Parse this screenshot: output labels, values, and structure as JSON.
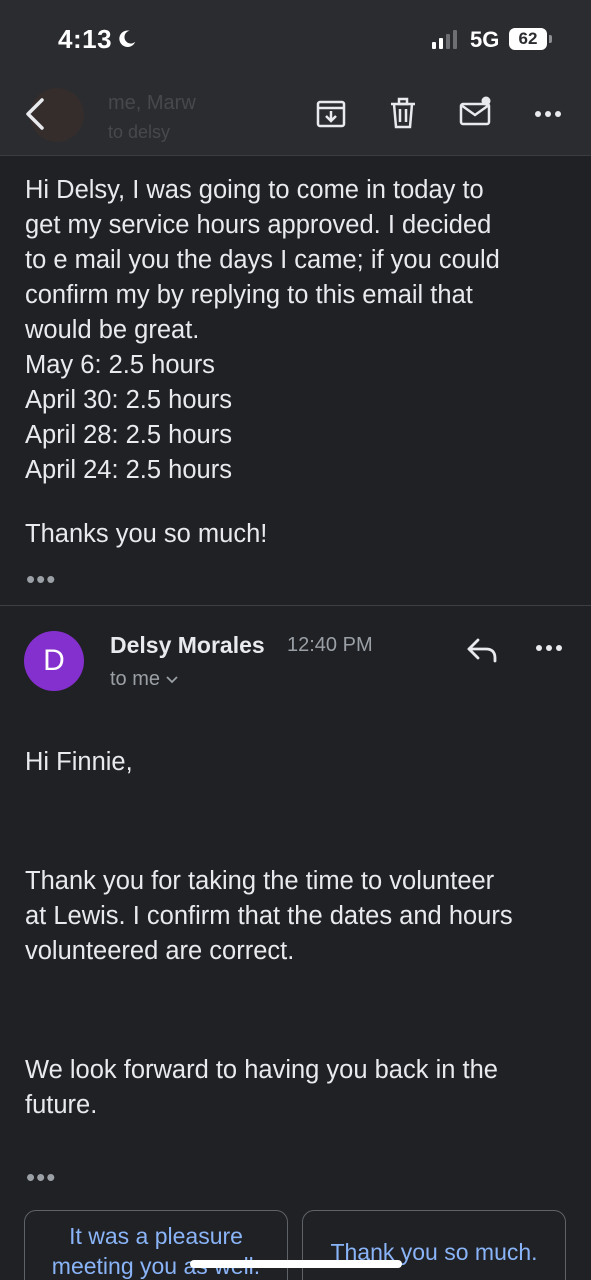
{
  "status_bar": {
    "time": "4:13",
    "network": "5G",
    "battery": "62"
  },
  "toolbar": {
    "ghost_title": "me, Marw",
    "ghost_subtitle": "to delsy"
  },
  "first_message": {
    "lines": [
      "Hi Delsy, I was going to come in today to",
      "get my service hours approved. I decided",
      "to e mail you the days I came; if you could",
      "confirm my by replying to this email that",
      "would be great.",
      "May 6: 2.5 hours",
      "April 30: 2.5 hours",
      "April 28: 2.5 hours",
      "April 24: 2.5 hours"
    ],
    "closing": "Thanks you so much!",
    "ellipsis": "•••"
  },
  "second_message": {
    "avatar_letter": "D",
    "avatar_color": "#8430ce",
    "sender": "Delsy Morales",
    "time": "12:40 PM",
    "recipient": "to me",
    "greeting": "Hi Finnie,",
    "para1_lines": [
      "Thank you for taking the time to volunteer",
      "at Lewis. I confirm that the dates and hours",
      "volunteered are correct."
    ],
    "para2_lines": [
      "We look forward to having you back in the",
      "future."
    ],
    "ellipsis": "•••"
  },
  "smart_replies": [
    "It was a pleasure meeting you as well.",
    "Thank you so much."
  ]
}
